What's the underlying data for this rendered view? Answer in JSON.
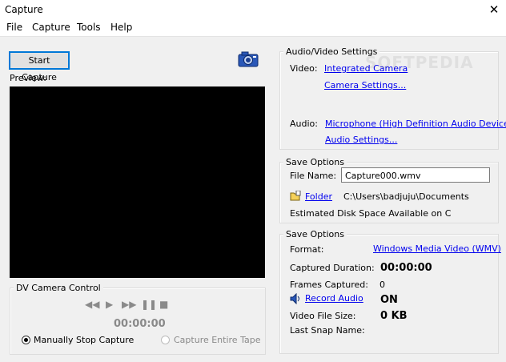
{
  "window": {
    "title": "Capture",
    "close_glyph": "✕"
  },
  "menu": [
    "File",
    "Capture",
    "Tools",
    "Help"
  ],
  "left": {
    "start_capture": "Start Capture",
    "preview_label": "Preview:",
    "snapshot_icon": "camera-icon"
  },
  "dv": {
    "legend": "DV Camera Control",
    "time": "00:00:00",
    "controls": {
      "rewind": "◀◀",
      "play": "▶",
      "fast_forward": "▶▶",
      "pause": "❚❚",
      "stop": "■"
    },
    "manual_stop": "Manually Stop Capture",
    "entire_tape": "Capture Entire Tape"
  },
  "av": {
    "legend": "Audio/Video Settings",
    "video_label": "Video:",
    "video_device": "Integrated Camera",
    "camera_settings": "Camera Settings...",
    "audio_label": "Audio:",
    "audio_device": "Microphone (High Definition Audio Device)",
    "audio_settings": "Audio Settings..."
  },
  "save1": {
    "legend": "Save Options",
    "file_name_label": "File Name:",
    "file_name_value": "Capture000.wmv",
    "folder_link": "Folder",
    "folder_path": "C:\\Users\\badjuju\\Documents",
    "disk_space": "Estimated Disk Space Available on C"
  },
  "save2": {
    "legend": "Save Options",
    "format_label": "Format:",
    "format_value": "Windows Media Video (WMV)",
    "duration_label": "Captured Duration:",
    "duration_value": "00:00:00",
    "frames_label": "Frames Captured:",
    "frames_value": "0",
    "record_audio_link": "Record Audio",
    "record_audio_value": "ON",
    "file_size_label": "Video File Size:",
    "file_size_value": "0 KB",
    "last_snap_label": "Last Snap Name:"
  },
  "watermark": "SOFTPEDIA"
}
